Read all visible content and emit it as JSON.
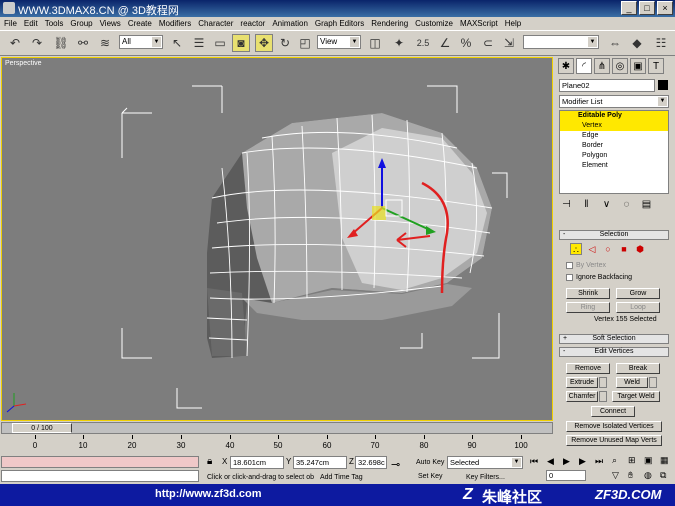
{
  "title_bar": {
    "title": "WWW.3DMAX8.CN @ 3D教程网"
  },
  "menu": [
    "File",
    "Edit",
    "Tools",
    "Group",
    "Views",
    "Create",
    "Modifiers",
    "Character",
    "reactor",
    "Animation",
    "Graph Editors",
    "Rendering",
    "Customize",
    "MAXScript",
    "Help"
  ],
  "toolbar": {
    "selection_filter": "All",
    "reference_coord": "View",
    "zoom_label": "2.5"
  },
  "viewport": {
    "label": "Perspective"
  },
  "command_panel": {
    "object_name": "Plane02",
    "modifier_list": "Modifier List",
    "stack": {
      "root": "Editable Poly",
      "items": [
        "Vertex",
        "Edge",
        "Border",
        "Polygon",
        "Element"
      ]
    },
    "selection": {
      "header": "Selection",
      "by_vertex": "By Vertex",
      "ignore_backfacing": "Ignore Backfacing",
      "shrink": "Shrink",
      "grow": "Grow",
      "ring": "Ring",
      "loop": "Loop",
      "status": "Vertex 155 Selected"
    },
    "soft_selection": {
      "header": "Soft Selection"
    },
    "edit_vertices": {
      "header": "Edit Vertices",
      "remove": "Remove",
      "break": "Break",
      "extrude": "Extrude",
      "weld": "Weld",
      "chamfer": "Chamfer",
      "target_weld": "Target Weld",
      "connect": "Connect",
      "remove_isolated": "Remove Isolated Vertices",
      "remove_unused": "Remove Unused Map Verts"
    }
  },
  "timeline": {
    "frame": "0 / 100",
    "ticks": [
      "0",
      "10",
      "20",
      "30",
      "40",
      "50",
      "60",
      "70",
      "80",
      "90",
      "100"
    ]
  },
  "status_bar": {
    "x_label": "X",
    "x": "18.601cm",
    "y_label": "Y",
    "y": "35.247cm",
    "z_label": "Z",
    "z": "32.698c",
    "prompt": "Click or click-and-drag to select ob",
    "add_time_tag": "Add Time Tag",
    "auto_key": "Auto Key",
    "set_key": "Set Key",
    "key_mode": "Selected",
    "key_filters": "Key Filters...",
    "frame_value": "0"
  },
  "banner": {
    "url": "http://www.zf3d.com",
    "site_name": "朱峰社区",
    "domain": "ZF3D.COM"
  }
}
